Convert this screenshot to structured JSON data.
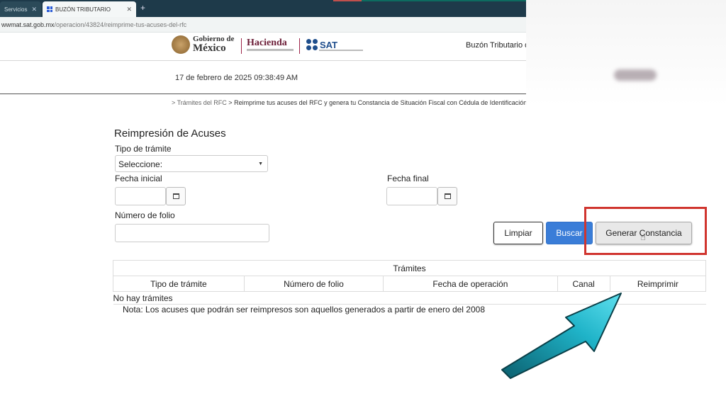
{
  "browser": {
    "tabs": [
      {
        "label": "Servicios",
        "active": false
      },
      {
        "label": "BUZÓN TRIBUTARIO",
        "active": true
      }
    ],
    "url_host": "wwmat.sat.gob.mx",
    "url_path": "/operacion/43824/reimprime-tus-acuses-del-rfc"
  },
  "header": {
    "gob_small": "Gobierno de",
    "gob_big": "México",
    "hacienda": "Hacienda",
    "sat": "SAT",
    "buzon_title": "Buzón Tributario d"
  },
  "datetime": "17 de febrero de 2025 09:38:49 AM",
  "breadcrumb": {
    "link": "> Trámites del RFC",
    "separator": ">",
    "current": "Reimprime tus acuses del RFC y genera tu Constancia de Situación Fiscal con Cédula de Identificación Fiscal."
  },
  "form": {
    "title": "Reimpresión de Acuses",
    "tipo_label": "Tipo de trámite",
    "tipo_value": "Seleccione:",
    "fecha_inicial_label": "Fecha inicial",
    "fecha_final_label": "Fecha final",
    "folio_label": "Número de folio"
  },
  "buttons": {
    "limpiar": "Limpiar",
    "buscar": "Buscar",
    "generar": "Generar Constancia"
  },
  "table": {
    "caption": "Trámites",
    "columns": [
      "Tipo de trámite",
      "Número de folio",
      "Fecha de operación",
      "Canal",
      "Reimprimir"
    ],
    "empty": "No hay trámites"
  },
  "note": "Nota: Los acuses que podrán ser reimpresos son aquellos generados a partir de enero del 2008",
  "colors": {
    "buscar": "#3a7dd8",
    "highlight": "#d0352f",
    "arrow": "#1fb3c8"
  }
}
